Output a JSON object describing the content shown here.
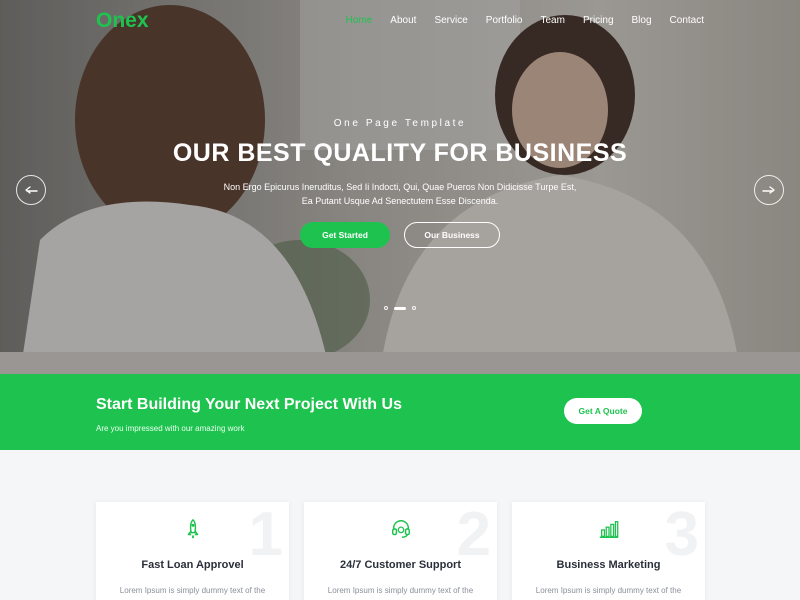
{
  "brand": {
    "name": "Onex",
    "accent": "#1ec34f"
  },
  "nav": {
    "items": [
      {
        "label": "Home",
        "active": true
      },
      {
        "label": "About"
      },
      {
        "label": "Service"
      },
      {
        "label": "Portfolio"
      },
      {
        "label": "Team"
      },
      {
        "label": "Pricing"
      },
      {
        "label": "Blog"
      },
      {
        "label": "Contact"
      }
    ]
  },
  "hero": {
    "kicker": "One Page Template",
    "headline": "OUR BEST QUALITY FOR BUSINESS",
    "subtext": "Non Ergo Epicurus Ineruditus, Sed Ii Indocti, Qui, Quae Pueros Non Didicisse Turpe Est, Ea Putant Usque Ad Senectutem Esse Discenda.",
    "primary_button": "Get Started",
    "secondary_button": "Our Business",
    "prev_icon": "arrow-left-icon",
    "next_icon": "arrow-right-icon",
    "slides": 3,
    "active_slide": 2
  },
  "cta": {
    "title": "Start Building Your Next Project With Us",
    "subtitle": "Are you impressed with our amazing work",
    "button": "Get A Quote"
  },
  "features": [
    {
      "number": "1",
      "icon": "rocket-icon",
      "title": "Fast Loan Approvel",
      "text": "Lorem Ipsum is simply dummy text of the printing and typesetting industry. Lorem"
    },
    {
      "number": "2",
      "icon": "headset-icon",
      "title": "24/7 Customer Support",
      "text": "Lorem Ipsum is simply dummy text of the printing and typesetting industry. Lorem"
    },
    {
      "number": "3",
      "icon": "bar-chart-icon",
      "title": "Business Marketing",
      "text": "Lorem Ipsum is simply dummy text of the printing and typesetting industry. Lorem"
    }
  ]
}
